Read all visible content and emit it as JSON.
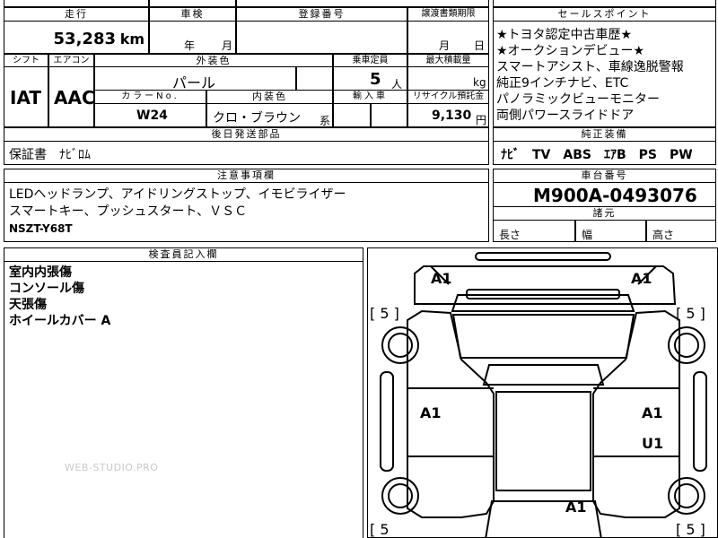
{
  "headers": {
    "mileage": "走行",
    "inspection": "車検",
    "registration": "登録番号",
    "transfer_deadline": "譲渡書類期限",
    "sales_point": "セールスポイント",
    "shift": "シフト",
    "aircon": "エアコン",
    "exterior_color": "外装色",
    "capacity": "乗車定員",
    "max_load": "最大積載量",
    "color_no": "カラーNo.",
    "interior_color": "内装色",
    "import": "輸入車",
    "recycle": "リサイクル預託金",
    "genuine_equipment": "純正装備",
    "later_parts": "後日発送部品",
    "notes": "注意事項欄",
    "chassis_no": "車台番号",
    "dimensions": "諸元",
    "inspector_notes": "検査員記入欄"
  },
  "mileage": {
    "value": "53,283",
    "unit": "km"
  },
  "inspection": {
    "year_label": "年",
    "month_label": "月"
  },
  "transfer_deadline": {
    "month_label": "月",
    "day_label": "日"
  },
  "shift": "IAT",
  "aircon": "AAC",
  "exterior_color": "パール",
  "capacity": {
    "value": "5",
    "unit": "人"
  },
  "max_load": {
    "unit": "kg"
  },
  "color_no": "W24",
  "interior_color": {
    "value": "クロ・ブラウン",
    "suffix": "系"
  },
  "recycle": {
    "value": "9,130",
    "unit": "円"
  },
  "sales_points": [
    "★トヨタ認定中古車歴★",
    "★オークションデビュー★",
    "スマートアシスト、車線逸脱警報",
    "純正9インチナビ、ETC",
    "パノラミックビューモニター",
    "両側パワースライドドア"
  ],
  "genuine_equipment": "ﾅﾋﾞ　TV　ABS　ｴｱB　PS　PW",
  "later_parts": "保証書　ﾅﾋﾞﾛﾑ",
  "notes": [
    "LEDヘッドランプ、アイドリングストップ、イモビライザー",
    "スマートキー、プッシュスタート、ＶＳＣ",
    "NSZT-Y68T"
  ],
  "chassis_no": "M900A-0493076",
  "dimensions": {
    "length_label": "長さ",
    "width_label": "幅",
    "height_label": "高さ"
  },
  "inspector_notes": [
    "室内内張傷",
    "コンソール傷",
    "天張傷",
    "ホイールカバー A"
  ],
  "diagram_marks": {
    "front_left": "A1",
    "front_right": "A1",
    "left_door": "A1",
    "right_door": "A1",
    "right_rear_door": "U1",
    "rear": "A1"
  },
  "tire_marks": {
    "front_left": "[ 5 ]",
    "front_right": "[ 5 ]",
    "rear_left": "[ 5",
    "rear_right": "[ 5 ]"
  },
  "watermark": "WEB-STUDIO.PRO"
}
